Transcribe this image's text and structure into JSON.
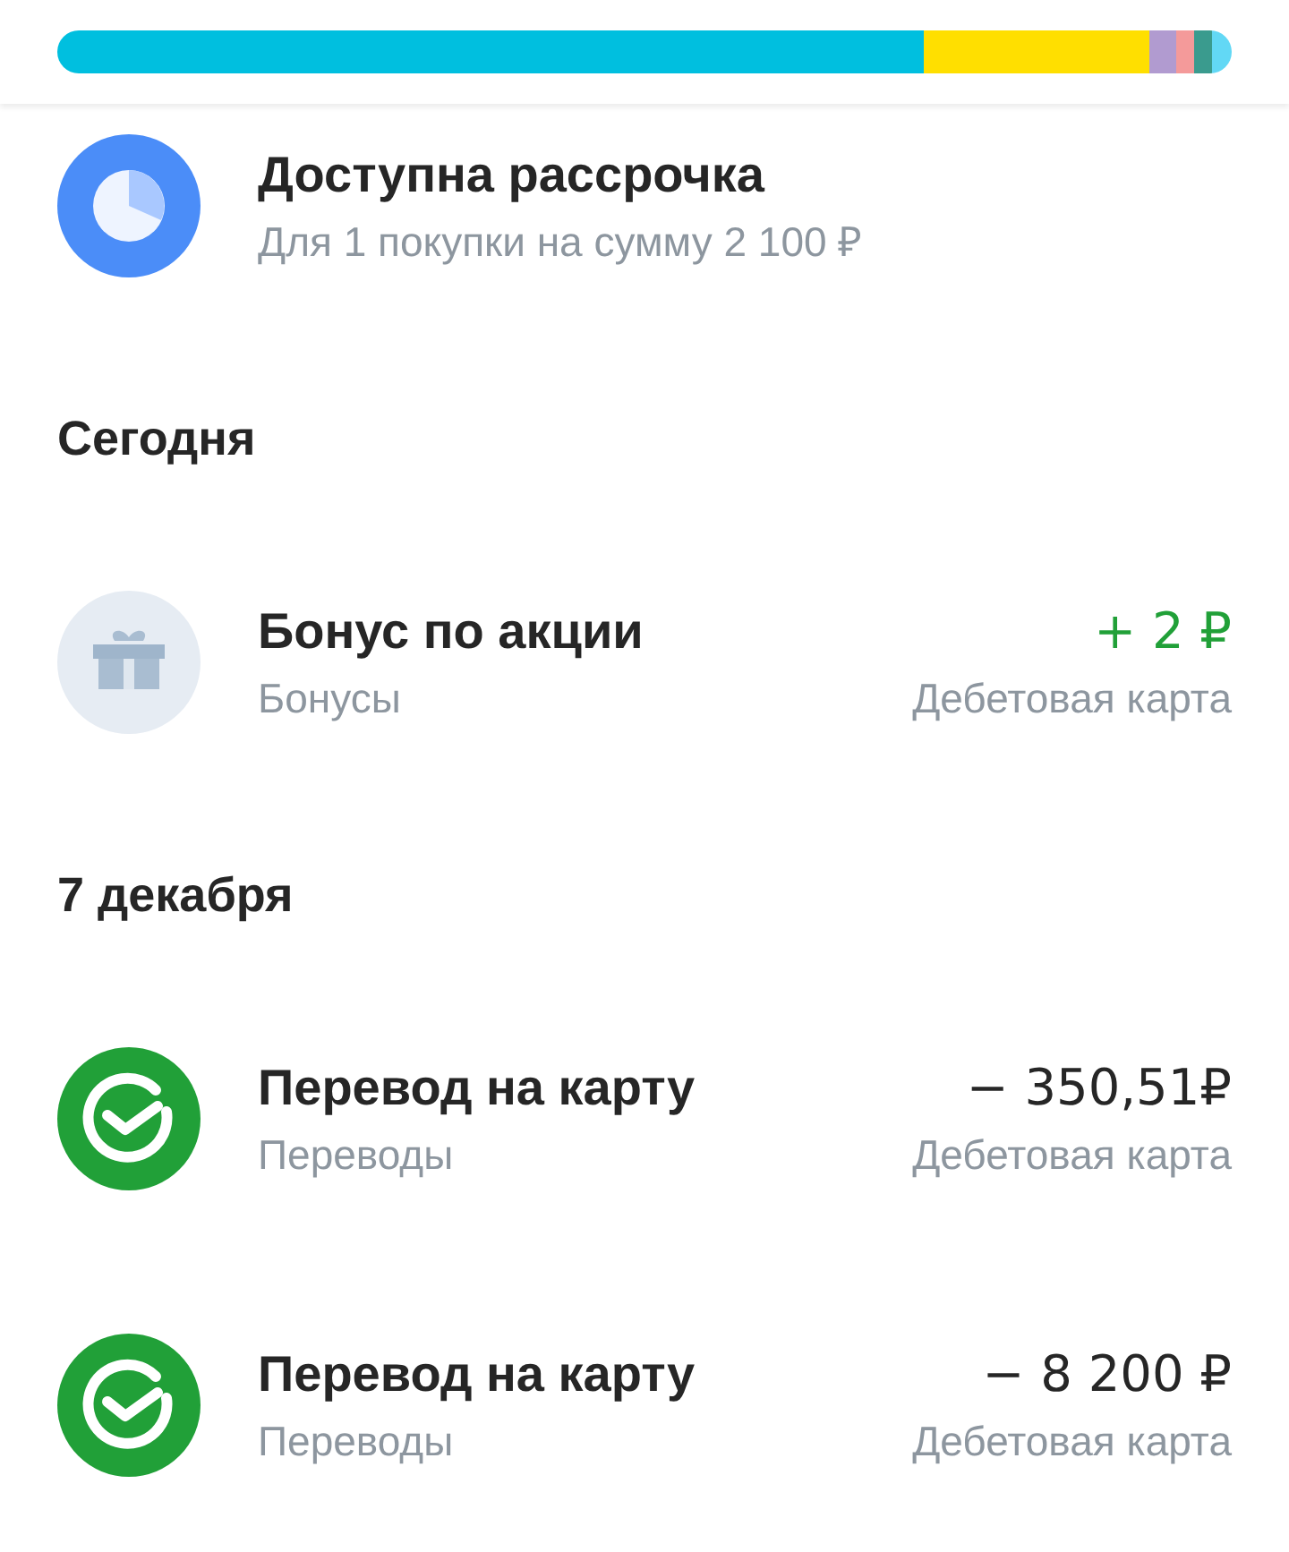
{
  "spending_bar": {
    "segments": [
      {
        "color": "#00bfdf"
      },
      {
        "color": "#ffdf00"
      },
      {
        "color": "#b19bd0"
      },
      {
        "color": "#f49a9a"
      },
      {
        "color": "#3a9b8e"
      },
      {
        "color": "#62d8f5"
      }
    ]
  },
  "installment": {
    "title": "Доступна рассрочка",
    "subtitle": "Для 1 покупки на сумму 2 100 ₽"
  },
  "sections": [
    {
      "heading": "Сегодня",
      "operations": [
        {
          "kind": "bonus",
          "title": "Бонус по акции",
          "category": "Бонусы",
          "amount": "+ 2 ₽",
          "income": true,
          "account": "Дебетовая карта"
        }
      ]
    },
    {
      "heading": "7 декабря",
      "operations": [
        {
          "kind": "transfer",
          "title": "Перевод на карту",
          "category": "Переводы",
          "amount": "− 350,51₽",
          "income": false,
          "account": "Дебетовая карта"
        },
        {
          "kind": "transfer",
          "title": "Перевод на карту",
          "category": "Переводы",
          "amount": "− 8 200 ₽",
          "income": false,
          "account": "Дебетовая карта"
        }
      ]
    }
  ]
}
